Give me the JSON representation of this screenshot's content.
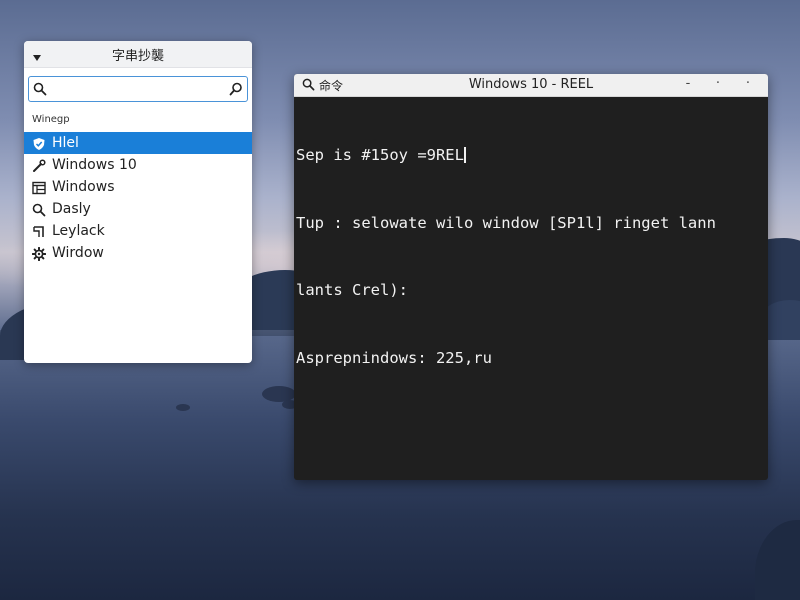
{
  "panel": {
    "title": "字串抄襲",
    "search": {
      "value": "",
      "placeholder": ""
    },
    "section_label": "Winegp",
    "items": [
      {
        "label": "Hlel",
        "icon": "shield-check-icon",
        "selected": true
      },
      {
        "label": "Windows 10",
        "icon": "wrench-icon",
        "selected": false
      },
      {
        "label": "Windows",
        "icon": "window-grid-icon",
        "selected": false
      },
      {
        "label": "Dasly",
        "icon": "search-icon",
        "selected": false
      },
      {
        "label": "Leylack",
        "icon": "bracket-icon",
        "selected": false
      },
      {
        "label": "Wirdow",
        "icon": "gear-icon",
        "selected": false
      }
    ]
  },
  "terminal": {
    "title": "Windows 10 - REEL",
    "title_left": "命令",
    "controls": {
      "minimize": "-",
      "maximize": "·",
      "close": "·"
    },
    "lines": [
      "Sep is #15oy =9REL",
      "Tup : selowate wilo window [SP1l] ringet lann",
      "lants Crel):",
      "Asprepnindows: 225,ru"
    ]
  },
  "colors": {
    "selection": "#1a7fd8",
    "terminal_bg": "#1f1f1f",
    "terminal_fg": "#f2f2f2"
  }
}
